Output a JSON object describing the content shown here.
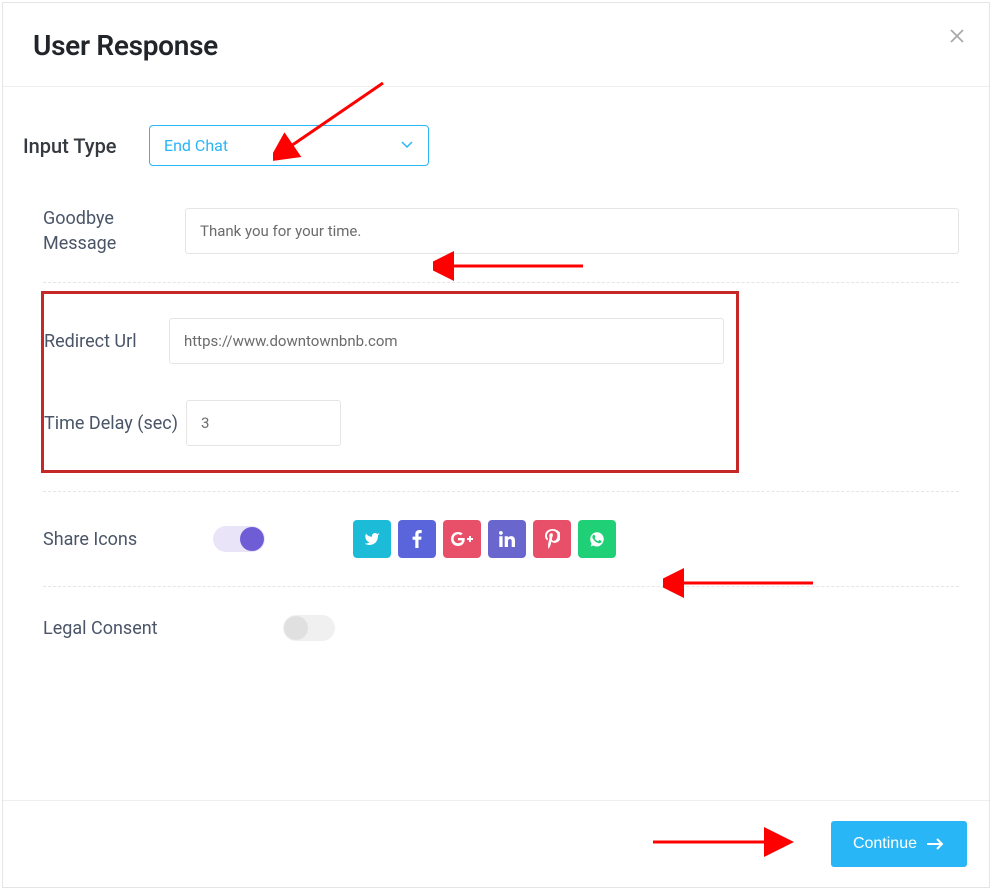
{
  "header": {
    "title": "User Response"
  },
  "inputType": {
    "label": "Input Type",
    "selected": "End Chat"
  },
  "goodbyeMessage": {
    "label": "Goodbye Message",
    "value": "Thank you for your time."
  },
  "redirectUrl": {
    "label": "Redirect Url",
    "value": "https://www.downtownbnb.com"
  },
  "timeDelay": {
    "label": "Time Delay (sec)",
    "value": "3"
  },
  "shareIcons": {
    "label": "Share Icons",
    "enabled": true
  },
  "legalConsent": {
    "label": "Legal Consent",
    "enabled": false
  },
  "footer": {
    "continueLabel": "Continue"
  }
}
